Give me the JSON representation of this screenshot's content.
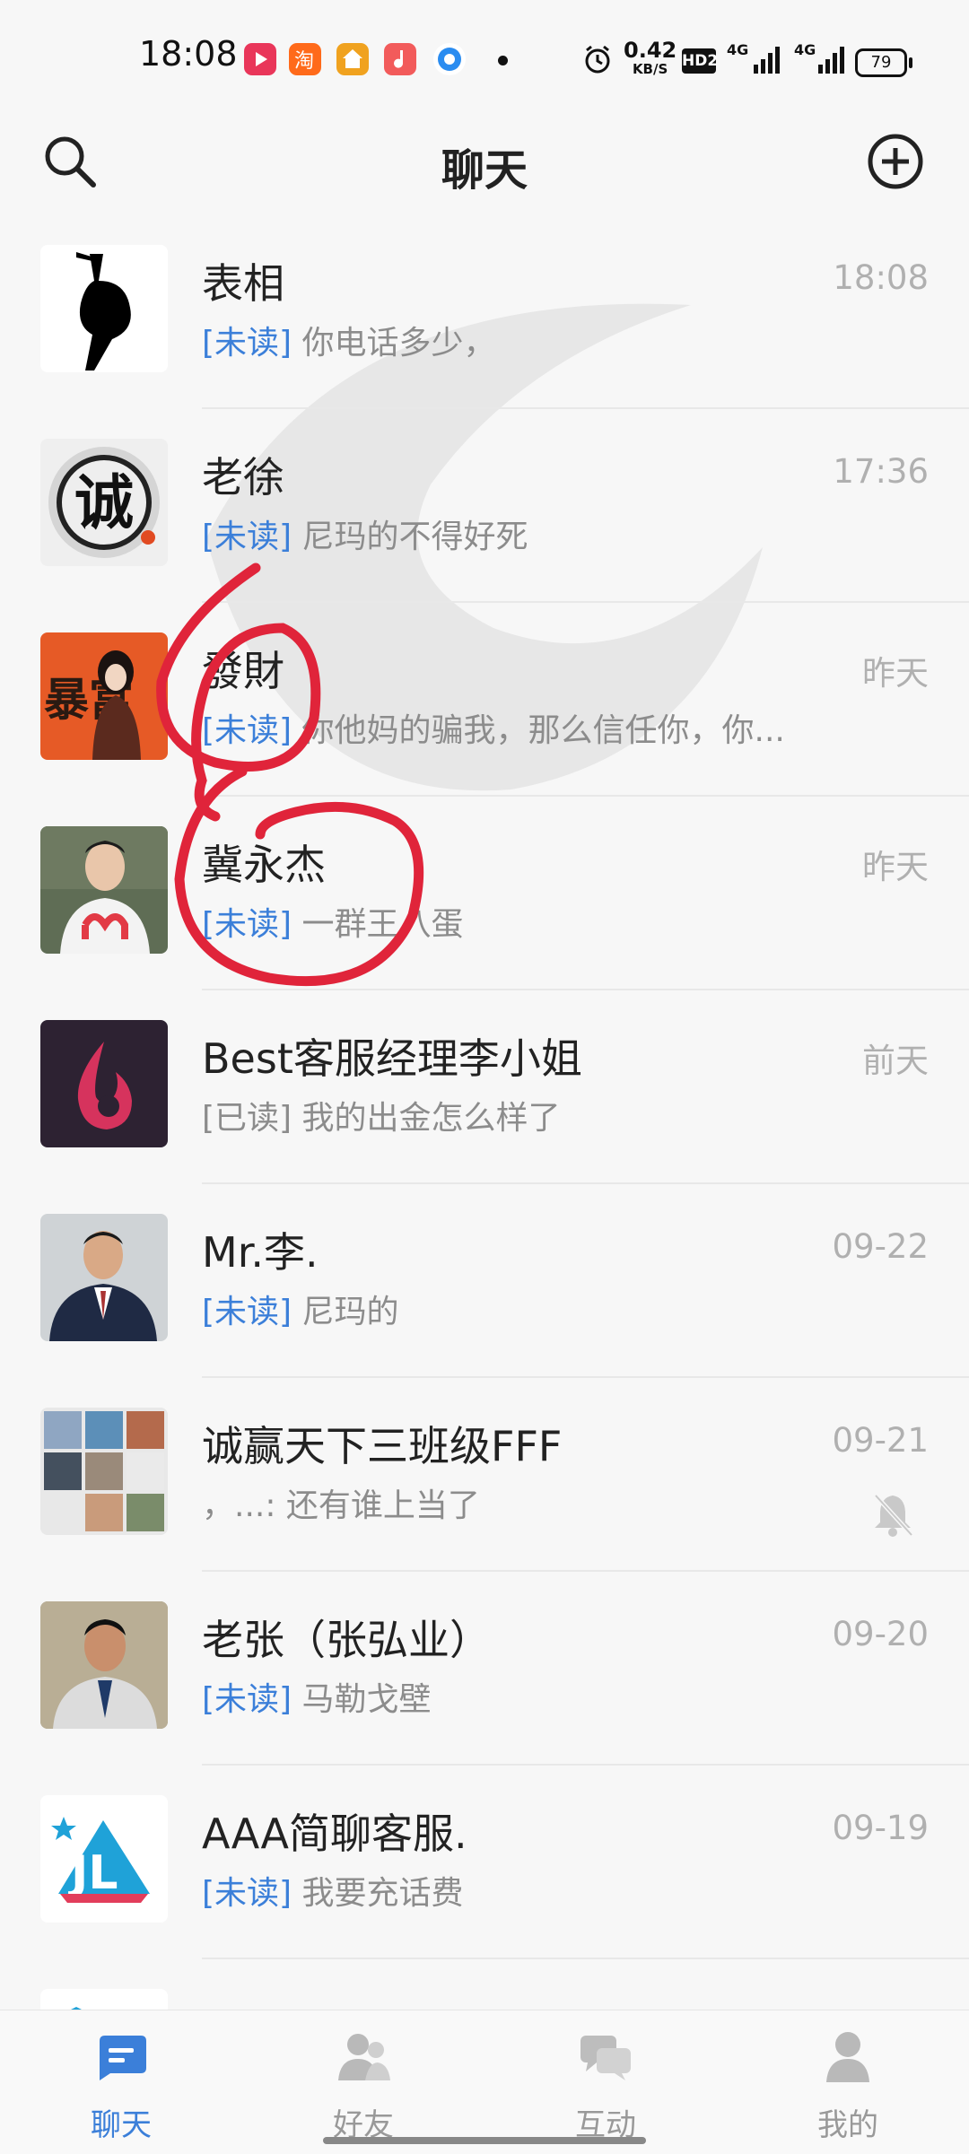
{
  "status_bar": {
    "time": "18:08",
    "net_speed_value": "0.42",
    "net_speed_unit": "KB/S",
    "hd_label": "HD2",
    "signal1": "4G",
    "signal2": "4G",
    "battery": "79"
  },
  "header": {
    "title": "聊天",
    "search_icon": "search-icon",
    "add_icon": "plus-circle-icon"
  },
  "chats": [
    {
      "name": "表相",
      "time": "18:08",
      "tag": "[未读]",
      "message": "你电话多少，",
      "read": false
    },
    {
      "name": "老徐",
      "time": "17:36",
      "tag": "[未读]",
      "message": "尼玛的不得好死",
      "read": false
    },
    {
      "name": "發財",
      "time": "昨天",
      "tag": "[未读]",
      "message": "你他妈的骗我，那么信任你，你...",
      "read": false
    },
    {
      "name": "冀永杰",
      "time": "昨天",
      "tag": "[未读]",
      "message": "一群王八蛋",
      "read": false
    },
    {
      "name": "Best客服经理李小姐",
      "time": "前天",
      "tag": "[已读]",
      "message": "我的出金怎么样了",
      "read": true
    },
    {
      "name": "Mr.李.",
      "time": "09-22",
      "tag": "[未读]",
      "message": "尼玛的",
      "read": false
    },
    {
      "name": "诚赢天下三班级FFF",
      "time": "09-21",
      "tag": "",
      "message": "，...: 还有谁上当了",
      "read": true,
      "muted": true
    },
    {
      "name": "老张（张弘业）",
      "time": "09-20",
      "tag": "[未读]",
      "message": "马勒戈壁",
      "read": false
    },
    {
      "name": "AAA简聊客服.",
      "time": "09-19",
      "tag": "[未读]",
      "message": "我要充话费",
      "read": false
    }
  ],
  "avatar_texts": {
    "chat_1": "诚",
    "chat_2": "暴富"
  },
  "bottom_nav": [
    {
      "label": "聊天",
      "icon": "chat-icon",
      "active": true
    },
    {
      "label": "好友",
      "icon": "friends-icon",
      "active": false
    },
    {
      "label": "互动",
      "icon": "interaction-icon",
      "active": false
    },
    {
      "label": "我的",
      "icon": "profile-icon",
      "active": false
    }
  ],
  "colors": {
    "accent": "#3b7fd9",
    "annotation": "#e0243a",
    "muted_text": "#8c8c8c"
  }
}
